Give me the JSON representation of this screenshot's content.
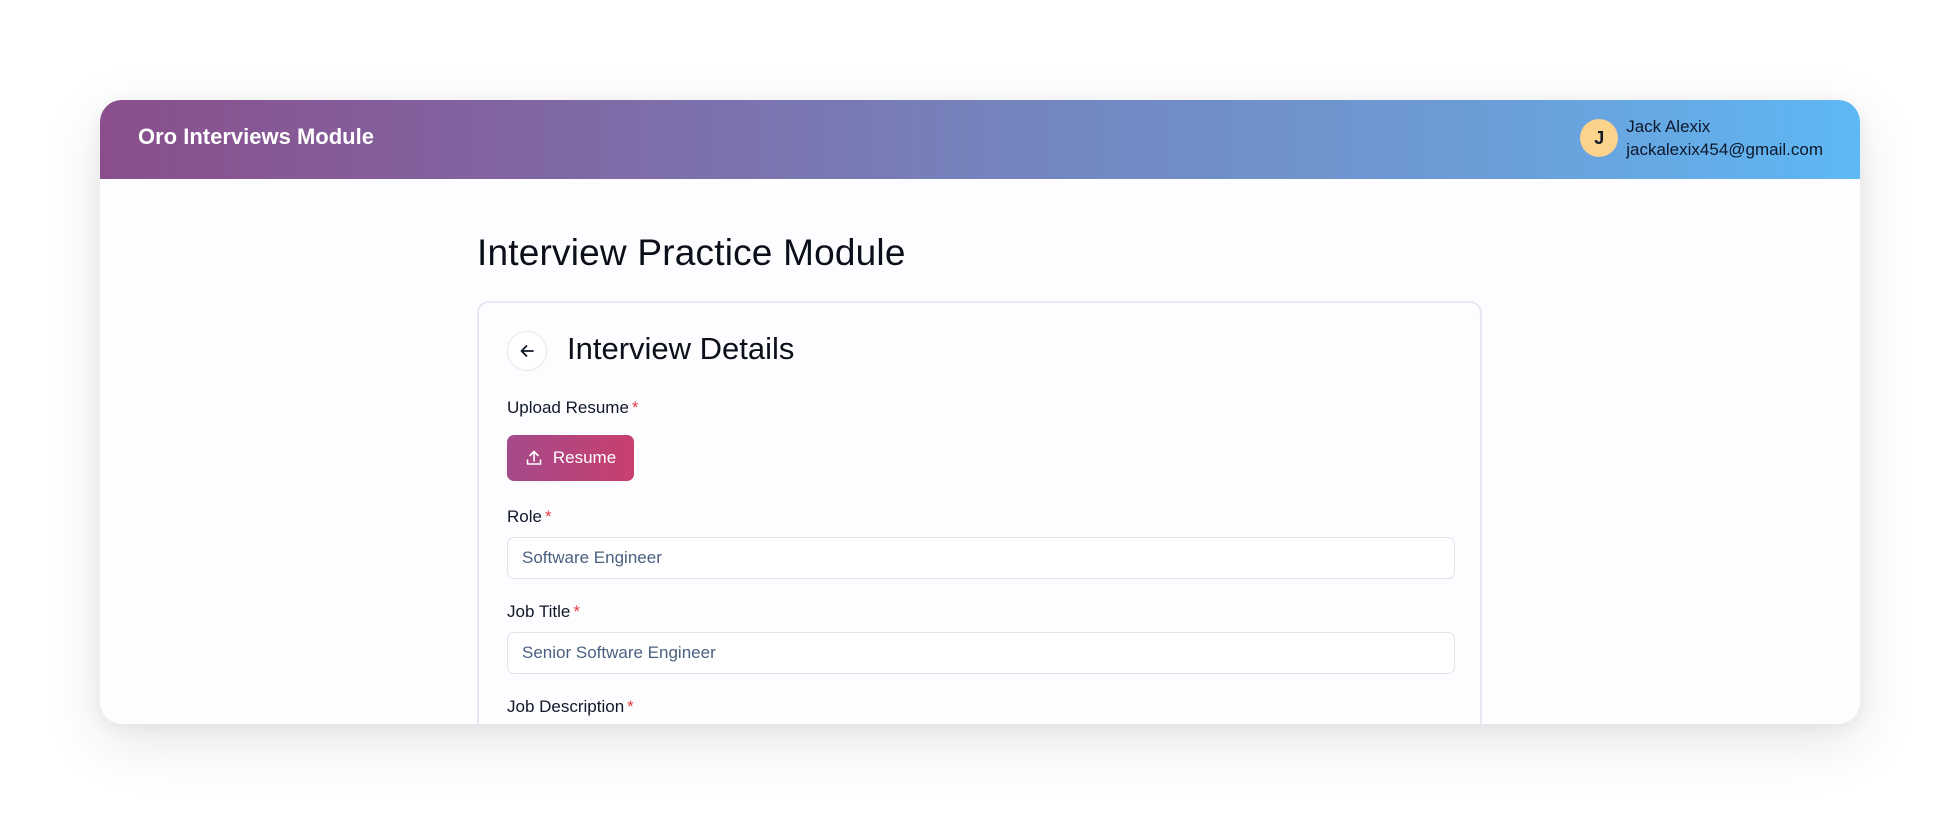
{
  "app": {
    "brand": "Oro Interviews Module"
  },
  "user": {
    "initial": "J",
    "name": "Jack Alexix",
    "email": "jackalexix454@gmail.com"
  },
  "page": {
    "title": "Interview Practice Module"
  },
  "card": {
    "title": "Interview Details",
    "back_icon": "arrow-left-icon"
  },
  "form": {
    "required_mark": "*",
    "resume": {
      "label": "Upload Resume",
      "button_label": "Resume",
      "icon": "upload-icon"
    },
    "role": {
      "label": "Role",
      "value": "Software Engineer"
    },
    "job_title": {
      "label": "Job Title",
      "value": "Senior Software Engineer"
    },
    "job_description": {
      "label": "Job Description"
    }
  },
  "colors": {
    "header_gradient_start": "#8a4e8c",
    "header_gradient_end": "#5eb8f4",
    "button_gradient_start": "#a44a8a",
    "button_gradient_end": "#c83f6e",
    "avatar_bg": "#fbd38d",
    "required": "#e53e3e"
  }
}
